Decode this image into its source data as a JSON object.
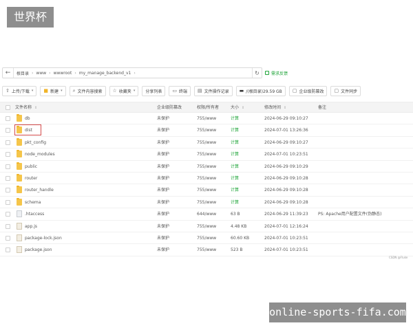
{
  "overlay": {
    "badge_text": "世界杯",
    "site_text": "online-sports-fifa.com"
  },
  "address_bar": {
    "crumbs": [
      "根目录",
      "www",
      "wwwroot",
      "my_manage_backend_v1"
    ],
    "feedback_label": "需求反馈"
  },
  "toolbar": {
    "upload_label": "上传/下载",
    "new_label": "新建",
    "search_label": "文件内容搜索",
    "favorites_label": "收藏夹",
    "share_label": "分享列表",
    "terminal_label": "终端",
    "oplog_label": "文件操作记录",
    "disk_label": "/(根目录)29.59 GB",
    "enterprise_label": "企业级防篡改",
    "sync_label": "文件同步"
  },
  "table": {
    "headers": {
      "name": "文件名称",
      "protect": "企业级防篡改",
      "perm": "权限/所有者",
      "size": "大小",
      "mtime": "修改时间",
      "note": "备注"
    },
    "rows": [
      {
        "name": "db",
        "type": "folder",
        "protect": "未保护",
        "perm": "755/www",
        "size": "计算",
        "mtime": "2024-06-29 09:10:27",
        "note": ""
      },
      {
        "name": "dist",
        "type": "folder",
        "protect": "未保护",
        "perm": "755/www",
        "size": "计算",
        "mtime": "2024-07-01 13:26:36",
        "note": ""
      },
      {
        "name": "pkt_config",
        "type": "folder",
        "protect": "未保护",
        "perm": "755/www",
        "size": "计算",
        "mtime": "2024-06-29 09:10:27",
        "note": ""
      },
      {
        "name": "node_modules",
        "type": "folder",
        "protect": "未保护",
        "perm": "755/www",
        "size": "计算",
        "mtime": "2024-07-01 10:23:51",
        "note": ""
      },
      {
        "name": "public",
        "type": "folder",
        "protect": "未保护",
        "perm": "755/www",
        "size": "计算",
        "mtime": "2024-06-29 09:10:29",
        "note": ""
      },
      {
        "name": "router",
        "type": "folder",
        "protect": "未保护",
        "perm": "755/www",
        "size": "计算",
        "mtime": "2024-06-29 09:10:28",
        "note": ""
      },
      {
        "name": "router_handle",
        "type": "folder",
        "protect": "未保护",
        "perm": "755/www",
        "size": "计算",
        "mtime": "2024-06-29 09:10:28",
        "note": ""
      },
      {
        "name": "schema",
        "type": "folder",
        "protect": "未保护",
        "perm": "755/www",
        "size": "计算",
        "mtime": "2024-06-29 09:10:28",
        "note": ""
      },
      {
        "name": ".htaccess",
        "type": "file",
        "protect": "未保护",
        "perm": "644/www",
        "size": "63 B",
        "mtime": "2024-06-29 11:39:23",
        "note": "PS: Apache用户配置文件(伪静态)"
      },
      {
        "name": "app.js",
        "type": "js",
        "protect": "未保护",
        "perm": "755/www",
        "size": "4.48 KB",
        "mtime": "2024-07-01 12:16:24",
        "note": ""
      },
      {
        "name": "package-lock.json",
        "type": "js",
        "protect": "未保护",
        "perm": "755/www",
        "size": "60.60 KB",
        "mtime": "2024-07-01 10:23:51",
        "note": ""
      },
      {
        "name": "package.json",
        "type": "js",
        "protect": "未保护",
        "perm": "755/www",
        "size": "523 B",
        "mtime": "2024-07-01 10:23:51",
        "note": ""
      }
    ]
  },
  "footer": {
    "watermark": "CSDN @Fluke"
  }
}
